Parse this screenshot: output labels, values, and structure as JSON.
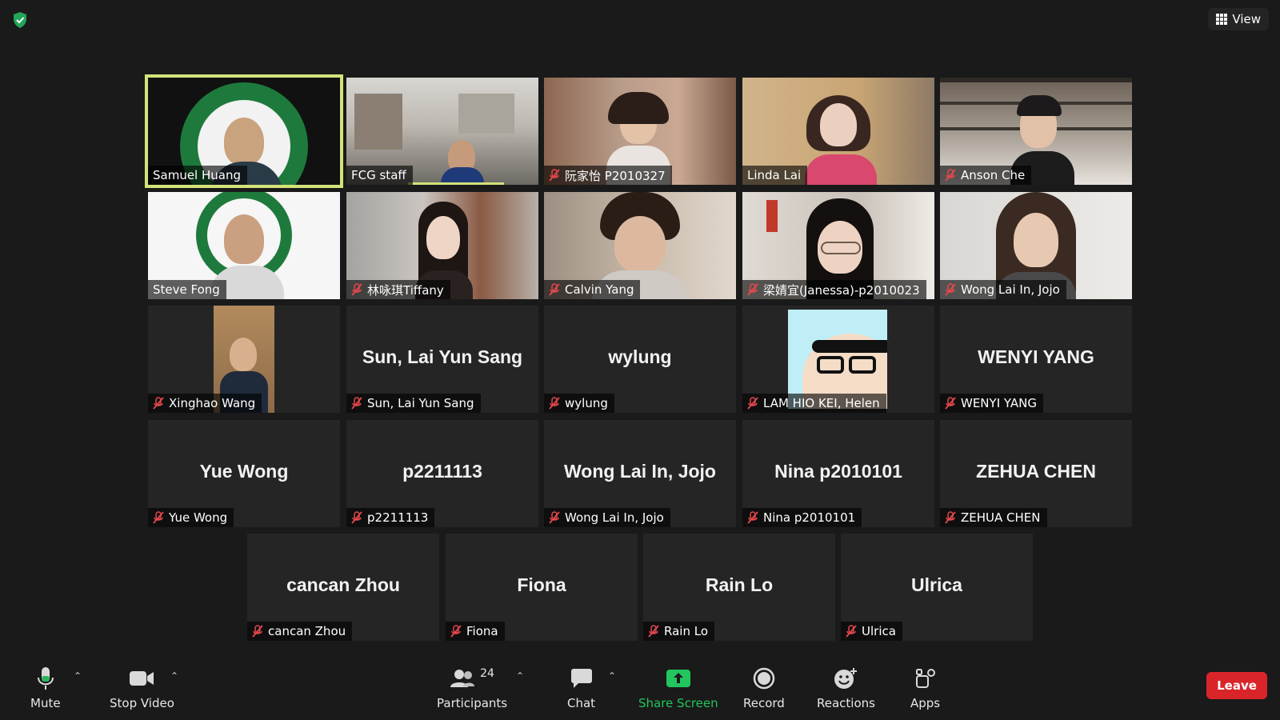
{
  "header": {
    "view_label": "View"
  },
  "participants": [
    {
      "name": "Samuel Huang",
      "type": "video",
      "muted": false,
      "active": true
    },
    {
      "name": "FCG staff",
      "type": "video",
      "muted": false
    },
    {
      "name": "阮家怡 P2010327",
      "type": "video",
      "muted": true
    },
    {
      "name": "Linda Lai",
      "type": "video",
      "muted": false
    },
    {
      "name": "Anson Che",
      "type": "video",
      "muted": true
    },
    {
      "name": "Steve Fong",
      "type": "video",
      "muted": false
    },
    {
      "name": "林咏琪Tiffany",
      "type": "video",
      "muted": true
    },
    {
      "name": "Calvin Yang",
      "type": "video",
      "muted": true
    },
    {
      "name": "梁婧宜(Janessa)-p2010023",
      "type": "video",
      "muted": true
    },
    {
      "name": "Wong Lai In, Jojo",
      "type": "video",
      "muted": true
    },
    {
      "name": "Xinghao Wang",
      "type": "photo",
      "muted": true
    },
    {
      "name": "Sun, Lai Yun Sang",
      "type": "name",
      "muted": true
    },
    {
      "name": "wylung",
      "type": "name",
      "muted": true
    },
    {
      "name": "LAM HIO KEI, Helen",
      "type": "avatar",
      "muted": true
    },
    {
      "name": "WENYI YANG",
      "type": "name",
      "muted": true
    },
    {
      "name": "Yue Wong",
      "type": "name",
      "muted": true
    },
    {
      "name": "p2211113",
      "type": "name",
      "muted": true
    },
    {
      "name": "Wong Lai In, Jojo",
      "type": "name",
      "muted": true
    },
    {
      "name": "Nina p2010101",
      "type": "name",
      "muted": true
    },
    {
      "name": "ZEHUA CHEN",
      "type": "name",
      "muted": true
    },
    {
      "name": "cancan Zhou",
      "type": "name",
      "muted": true
    },
    {
      "name": "Fiona",
      "type": "name",
      "muted": true
    },
    {
      "name": "Rain Lo",
      "type": "name",
      "muted": true
    },
    {
      "name": "Ulrica",
      "type": "name",
      "muted": true
    }
  ],
  "toolbar": {
    "mute": "Mute",
    "stop_video": "Stop Video",
    "participants": "Participants",
    "participants_count": "24",
    "chat": "Chat",
    "share_screen": "Share Screen",
    "record": "Record",
    "reactions": "Reactions",
    "apps": "Apps",
    "leave": "Leave"
  },
  "colors": {
    "active_speaker": "#d3e27a",
    "share_green": "#22c55e",
    "leave_red": "#d9252a",
    "mic_off_red": "#e5484d"
  }
}
